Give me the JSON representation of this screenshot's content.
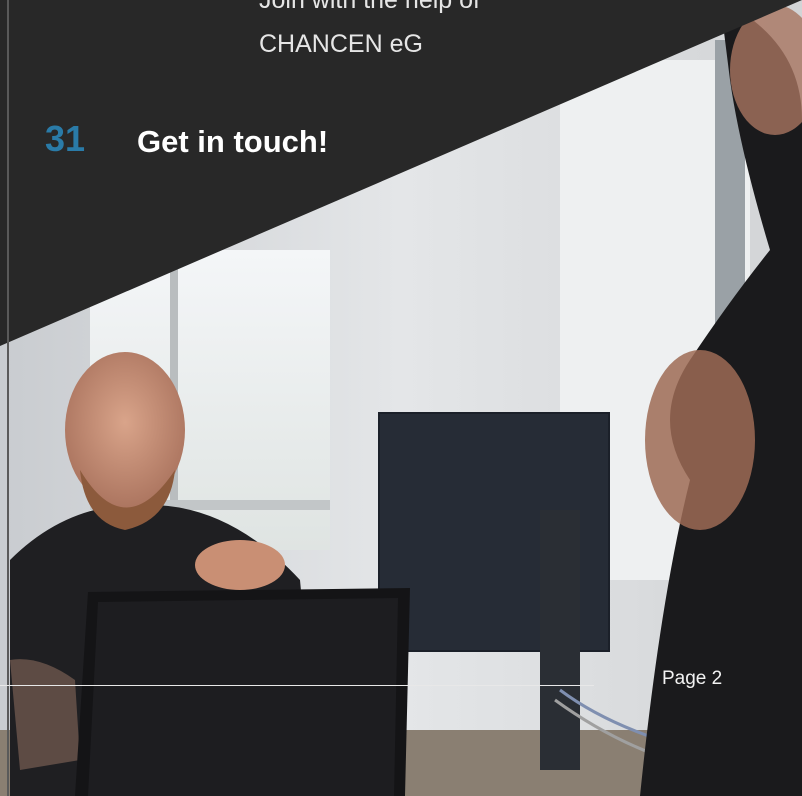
{
  "subtitle": {
    "line1": "Join with the help of",
    "line2": "CHANCEN eG"
  },
  "toc_entry": {
    "number": "31",
    "title": "Get in touch!"
  },
  "footer": {
    "page_label": "Page 2"
  },
  "colors": {
    "panel": "#282828",
    "accent": "#2a7ba8",
    "text": "#ffffff"
  },
  "photo": {
    "subject": "office-scene"
  }
}
